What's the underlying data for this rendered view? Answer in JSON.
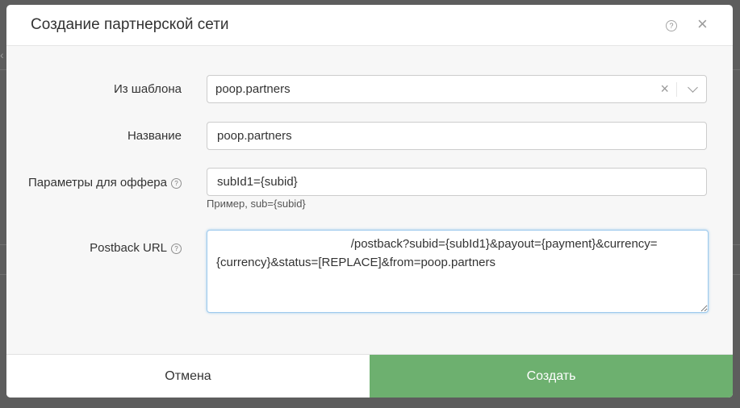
{
  "modal": {
    "title": "Создание партнерской сети",
    "help_glyph": "?",
    "close_glyph": "×"
  },
  "form": {
    "template": {
      "label": "Из шаблона",
      "value": "poop.partners",
      "clear_glyph": "×"
    },
    "name": {
      "label": "Название",
      "value": "poop.partners"
    },
    "offer_params": {
      "label": "Параметры для оффера",
      "help_glyph": "?",
      "value": "subId1={subid}",
      "hint": "Пример, sub={subid}"
    },
    "postback": {
      "label": "Postback URL",
      "help_glyph": "?",
      "value": "                                        /postback?subid={subId1}&payout={payment}&currency={currency}&status=[REPLACE]&from=poop.partners"
    }
  },
  "footer": {
    "cancel_label": "Отмена",
    "create_label": "Создать"
  },
  "colors": {
    "create_button": "#6db06f",
    "focus_border": "#9ecaed"
  }
}
